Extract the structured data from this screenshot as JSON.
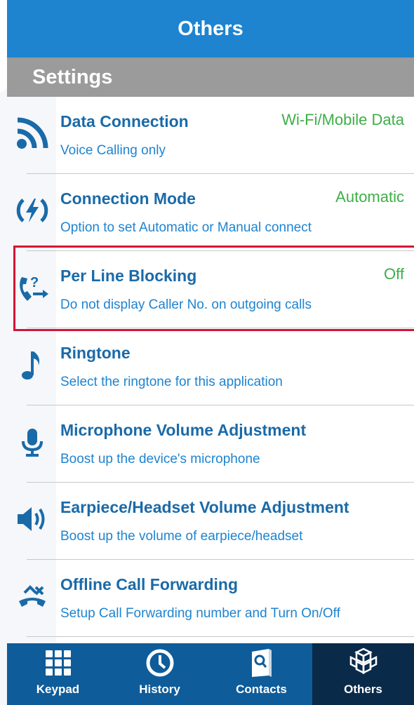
{
  "header": {
    "title": "Others"
  },
  "section": {
    "title": "Settings"
  },
  "settings": [
    {
      "title": "Data Connection",
      "subtitle": "Voice Calling only",
      "value": "Wi-Fi/Mobile Data",
      "icon": "wifi-icon"
    },
    {
      "title": "Connection Mode",
      "subtitle": "Option to set Automatic or Manual connect",
      "value": "Automatic",
      "icon": "lightning-icon"
    },
    {
      "title": "Per Line Blocking",
      "subtitle": "Do not display Caller No. on outgoing calls",
      "value": "Off",
      "icon": "phone-question-icon"
    },
    {
      "title": "Ringtone",
      "subtitle": "Select the ringtone for this application",
      "value": "",
      "icon": "music-note-icon"
    },
    {
      "title": "Microphone Volume Adjustment",
      "subtitle": "Boost up the device's microphone",
      "value": "",
      "icon": "microphone-icon"
    },
    {
      "title": "Earpiece/Headset Volume Adjustment",
      "subtitle": "Boost up the volume of earpiece/headset",
      "value": "",
      "icon": "speaker-icon"
    },
    {
      "title": "Offline Call Forwarding",
      "subtitle": "Setup Call Forwarding number and Turn On/Off",
      "value": "",
      "icon": "call-forward-icon"
    }
  ],
  "tabs": [
    {
      "label": "Keypad",
      "icon": "keypad-icon"
    },
    {
      "label": "History",
      "icon": "clock-icon"
    },
    {
      "label": "Contacts",
      "icon": "contacts-book-icon"
    },
    {
      "label": "Others",
      "icon": "cubes-icon"
    }
  ],
  "colors": {
    "header": "#1e84d0",
    "section": "#9b9b9b",
    "title": "#1a6aa8",
    "subtitle": "#1e84d0",
    "value": "#3fae49",
    "highlight": "#d31437",
    "tabbar": "#0f5c9a",
    "tab_active": "#0a2a4a"
  }
}
